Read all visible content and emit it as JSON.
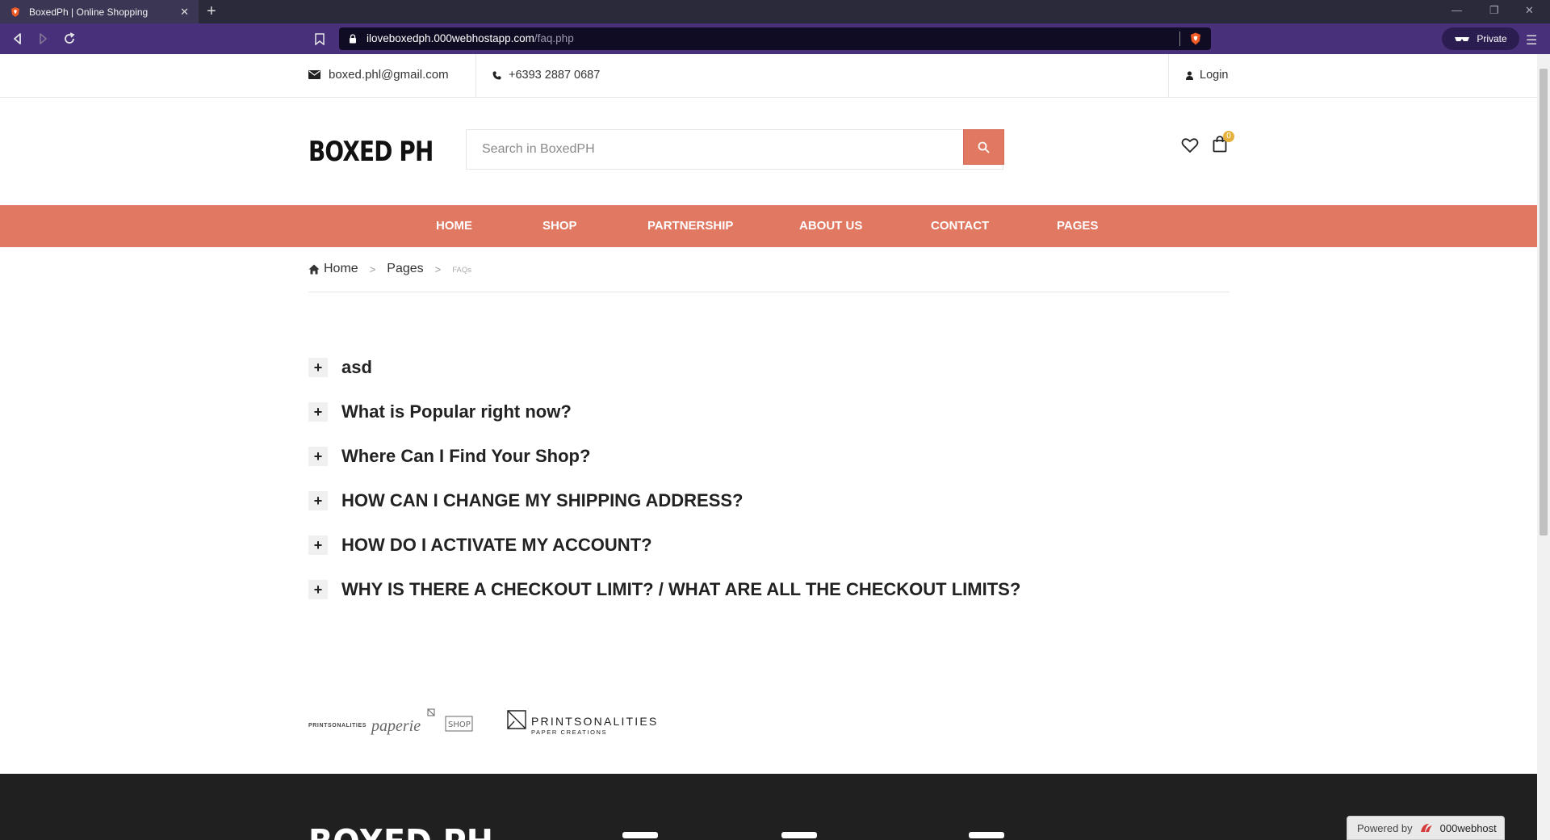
{
  "browser": {
    "tab_title": "BoxedPh | Online Shopping",
    "url_host": "iloveboxedph.000webhostapp.com",
    "url_path": "/faq.php",
    "private_label": "Private"
  },
  "topbar": {
    "email": "boxed.phl@gmail.com",
    "phone": "+6393 2887 0687",
    "login": "Login"
  },
  "header": {
    "logo": "BOXED PH",
    "search_placeholder": "Search in BoxedPH",
    "cart_count": "0"
  },
  "nav": {
    "items": [
      "HOME",
      "SHOP",
      "PARTNERSHIP",
      "ABOUT US",
      "CONTACT",
      "PAGES"
    ]
  },
  "breadcrumb": {
    "home": "Home",
    "pages": "Pages",
    "current": "FAQs"
  },
  "faq": {
    "questions": [
      "asd",
      "What is Popular right now?",
      "Where Can I Find Your Shop?",
      "HOW CAN I CHANGE MY SHIPPING ADDRESS?",
      "HOW DO I ACTIVATE MY ACCOUNT?",
      "WHY IS THERE A CHECKOUT LIMIT? / WHAT ARE ALL THE CHECKOUT LIMITS?"
    ]
  },
  "partners": {
    "logo1_small": "PRINTSONALITIES",
    "logo1_script": "paperie",
    "logo1_tag": "SHOP",
    "logo2_name": "PRINTSONALITIES",
    "logo2_sub": "PAPER CREATIONS"
  },
  "footer": {
    "logo": "BOXED PH"
  },
  "powered": {
    "prefix": "Powered by",
    "brand": "000webhost"
  },
  "colors": {
    "accent": "#e07862",
    "browser_toolbar": "#48307a",
    "badge": "#e6b13a",
    "footer": "#202020"
  }
}
